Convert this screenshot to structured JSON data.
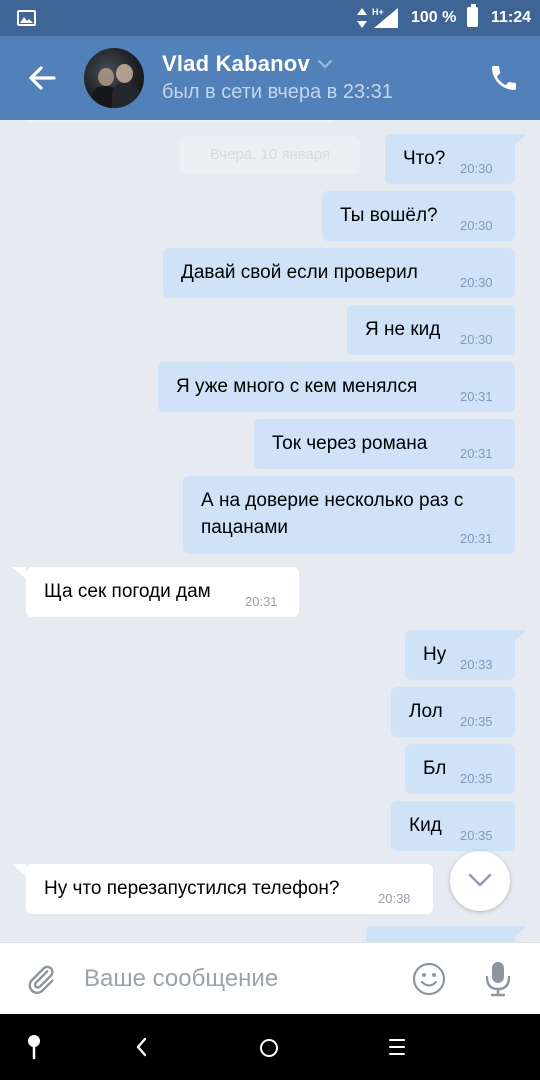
{
  "status_bar": {
    "network": "H+",
    "battery_percent": "100 %",
    "battery_level": 1.0,
    "time": "11:24"
  },
  "header": {
    "contact_name": "Vlad Kabanov",
    "last_seen": "был в сети вчера в 23:31",
    "back_icon": "arrow-left-icon",
    "call_icon": "phone-icon"
  },
  "chat": {
    "date_separator": "Вчера, 10 января",
    "messages": [
      {
        "direction": "out",
        "text": "Что?",
        "time": "20:30"
      },
      {
        "direction": "out",
        "text": "Ты вошёл?",
        "time": "20:30"
      },
      {
        "direction": "out",
        "text": "Давай свой если проверил",
        "time": "20:30"
      },
      {
        "direction": "out",
        "text": "Я не кид",
        "time": "20:30"
      },
      {
        "direction": "out",
        "text": "Я уже много с кем менялся",
        "time": "20:31"
      },
      {
        "direction": "out",
        "text": "Ток через романа",
        "time": "20:31"
      },
      {
        "direction": "out",
        "text_line1": "А на доверие несколько раз с",
        "text_line2": "пацанами",
        "time": "20:31"
      },
      {
        "direction": "in",
        "text": "Ща сек погоди дам",
        "time": "20:31"
      },
      {
        "direction": "out",
        "text": "Ну",
        "time": "20:33"
      },
      {
        "direction": "out",
        "text": "Лол",
        "time": "20:35"
      },
      {
        "direction": "out",
        "text": "Бл",
        "time": "20:35"
      },
      {
        "direction": "out",
        "text": "Кид",
        "time": "20:35"
      },
      {
        "direction": "in",
        "text": "Ну что перезапустился телефон?",
        "time": "20:38"
      }
    ]
  },
  "composer": {
    "placeholder": "Ваше сообщение",
    "attach_icon": "paperclip-icon",
    "emoji_icon": "smiley-icon",
    "mic_icon": "microphone-icon"
  },
  "colors": {
    "status_bar": "#3f6597",
    "header": "#5181b8",
    "chat_bg": "#e6ebf1",
    "outgoing_bubble": "#cfe2f8",
    "incoming_bubble": "#ffffff"
  }
}
